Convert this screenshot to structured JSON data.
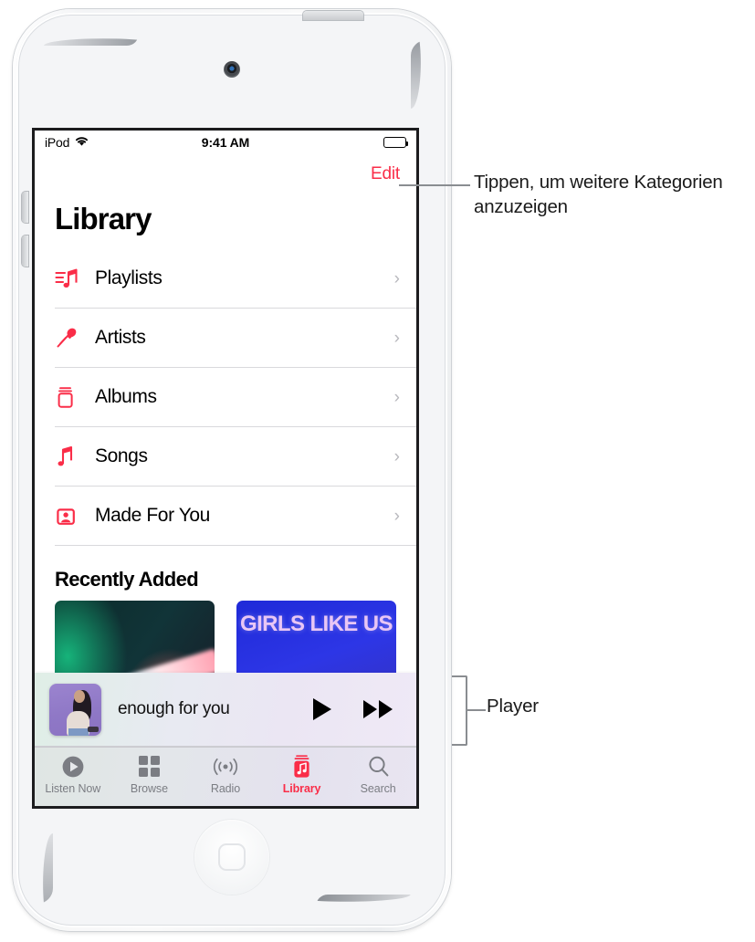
{
  "device": {
    "name": "iPod touch",
    "camera": "front-camera",
    "home_button": "home-button"
  },
  "status_bar": {
    "carrier": "iPod",
    "wifi_icon": "wifi-icon",
    "time": "9:41 AM",
    "battery_icon": "battery-full-icon"
  },
  "nav": {
    "edit_label": "Edit",
    "edit_color": "#fa2d48"
  },
  "page": {
    "title": "Library"
  },
  "library_items": [
    {
      "label": "Playlists",
      "icon": "playlist-music-icon",
      "chevron": "›"
    },
    {
      "label": "Artists",
      "icon": "microphone-icon",
      "chevron": "›"
    },
    {
      "label": "Albums",
      "icon": "album-stack-icon",
      "chevron": "›"
    },
    {
      "label": "Songs",
      "icon": "music-note-icon",
      "chevron": "›"
    },
    {
      "label": "Made For You",
      "icon": "person-square-icon",
      "chevron": "›"
    }
  ],
  "recently_added": {
    "title": "Recently Added",
    "albums": [
      {
        "artwork_name": "album-artwork-neon-light",
        "overlay_text": ""
      },
      {
        "artwork_name": "album-artwork-girls-like-us",
        "overlay_text": "GIRLS LIKE US"
      }
    ]
  },
  "player": {
    "artwork_name": "now-playing-artwork",
    "track_title": "enough for you",
    "play_icon": "play-icon",
    "forward_icon": "fast-forward-icon"
  },
  "tabs": [
    {
      "label": "Listen Now",
      "icon": "play-circle-icon",
      "active": false
    },
    {
      "label": "Browse",
      "icon": "grid-squares-icon",
      "active": false
    },
    {
      "label": "Radio",
      "icon": "broadcast-icon",
      "active": false
    },
    {
      "label": "Library",
      "icon": "library-icon",
      "active": true
    },
    {
      "label": "Search",
      "icon": "search-icon",
      "active": false
    }
  ],
  "callouts": {
    "edit": "Tippen, um weitere Kategorien anzuzeigen",
    "player": "Player"
  },
  "colors": {
    "accent": "#fa2d48",
    "separator": "#d9d9dc",
    "tab_inactive": "#7b7d83",
    "callout_line": "#8a8d91"
  }
}
